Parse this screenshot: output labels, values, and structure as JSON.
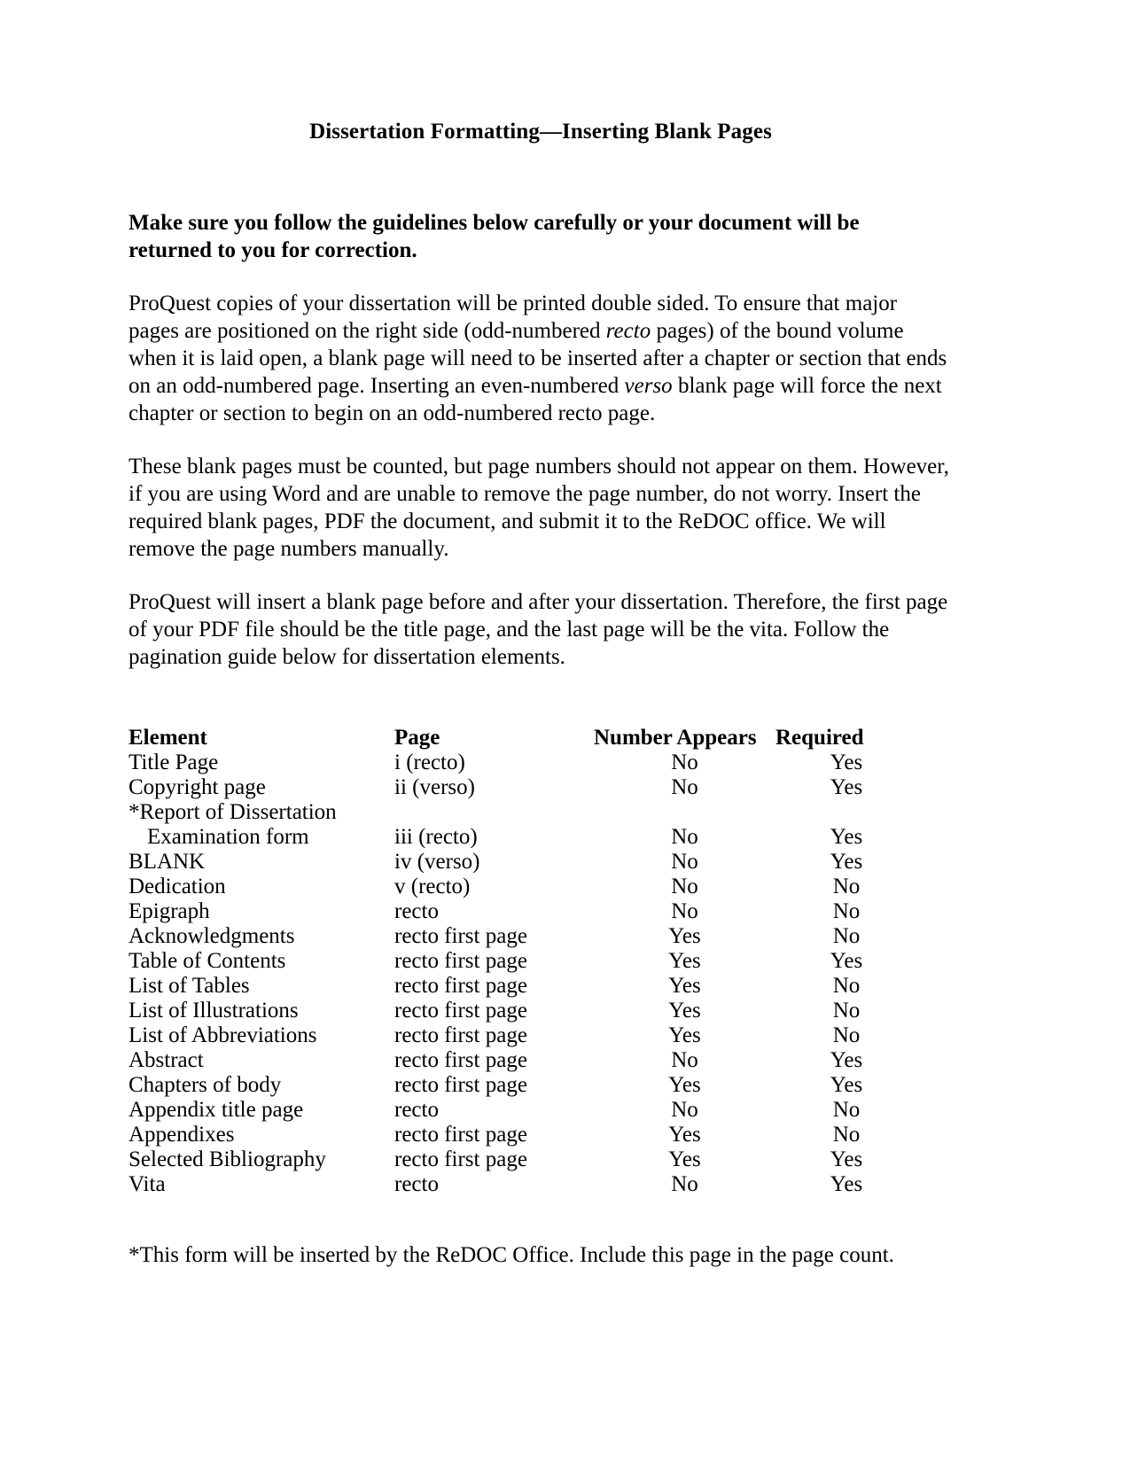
{
  "document": {
    "title": "Dissertation Formatting—Inserting Blank Pages",
    "lead": "Make sure you follow the guidelines below carefully or your document will be returned to you for correction.",
    "paragraphs": {
      "p1_a": "ProQuest copies of your dissertation will be printed double sided. To ensure that major pages are positioned on the right side (odd-numbered ",
      "p1_i1": "recto",
      "p1_b": " pages) of the bound volume when it is laid open, a blank page will need to be inserted after a chapter or section that ends on an odd-numbered page. Inserting an even-numbered ",
      "p1_i2": "verso",
      "p1_c": " blank page will force the next chapter or section to begin on an odd-numbered recto page.",
      "p2": "These blank pages must be counted, but page numbers should not appear on them. However, if you are using Word and are unable to remove the page number, do not worry. Insert the required blank pages, PDF the document, and submit it to the ReDOC office. We will remove the page numbers manually.",
      "p3": "ProQuest will insert a blank page before and after your dissertation. Therefore, the first page of your PDF file should be the title page, and the last page will be the vita. Follow the pagination guide below for dissertation elements."
    },
    "footnote": "*This form will be inserted by the ReDOC Office. Include this page in the page count."
  },
  "table": {
    "headers": {
      "element": "Element",
      "page": "Page",
      "number_appears": "Number Appears",
      "required": "Required"
    },
    "rows": [
      {
        "element": "Title Page",
        "page": "i (recto)",
        "number_appears": "No",
        "required": "Yes",
        "indent": false
      },
      {
        "element": "Copyright page",
        "page": "ii (verso)",
        "number_appears": "No",
        "required": "Yes",
        "indent": false
      },
      {
        "element": "*Report of Dissertation",
        "page": "",
        "number_appears": "",
        "required": "",
        "indent": false
      },
      {
        "element": "Examination form",
        "page": "iii (recto)",
        "number_appears": "No",
        "required": "Yes",
        "indent": true
      },
      {
        "element": "BLANK",
        "page": "iv (verso)",
        "number_appears": "No",
        "required": "Yes",
        "indent": false
      },
      {
        "element": "Dedication",
        "page": "v (recto)",
        "number_appears": "No",
        "required": "No",
        "indent": false
      },
      {
        "element": "Epigraph",
        "page": "recto",
        "number_appears": "No",
        "required": "No",
        "indent": false
      },
      {
        "element": "Acknowledgments",
        "page": "recto first page",
        "number_appears": "Yes",
        "required": "No",
        "indent": false
      },
      {
        "element": "Table of Contents",
        "page": "recto first page",
        "number_appears": "Yes",
        "required": "Yes",
        "indent": false
      },
      {
        "element": "List of Tables",
        "page": "recto first page",
        "number_appears": "Yes",
        "required": "No",
        "indent": false
      },
      {
        "element": "List of Illustrations",
        "page": "recto first page",
        "number_appears": "Yes",
        "required": "No",
        "indent": false
      },
      {
        "element": "List of Abbreviations",
        "page": "recto first page",
        "number_appears": "Yes",
        "required": "No",
        "indent": false
      },
      {
        "element": "Abstract",
        "page": "recto first page",
        "number_appears": "No",
        "required": "Yes",
        "indent": false
      },
      {
        "element": "Chapters of body",
        "page": "recto first page",
        "number_appears": "Yes",
        "required": "Yes",
        "indent": false
      },
      {
        "element": "Appendix title page",
        "page": "recto",
        "number_appears": "No",
        "required": "No",
        "indent": false
      },
      {
        "element": "Appendixes",
        "page": "recto first page",
        "number_appears": "Yes",
        "required": "No",
        "indent": false
      },
      {
        "element": "Selected Bibliography",
        "page": "recto first page",
        "number_appears": "Yes",
        "required": "Yes",
        "indent": false
      },
      {
        "element": "Vita",
        "page": "recto",
        "number_appears": "No",
        "required": "Yes",
        "indent": false
      }
    ]
  }
}
